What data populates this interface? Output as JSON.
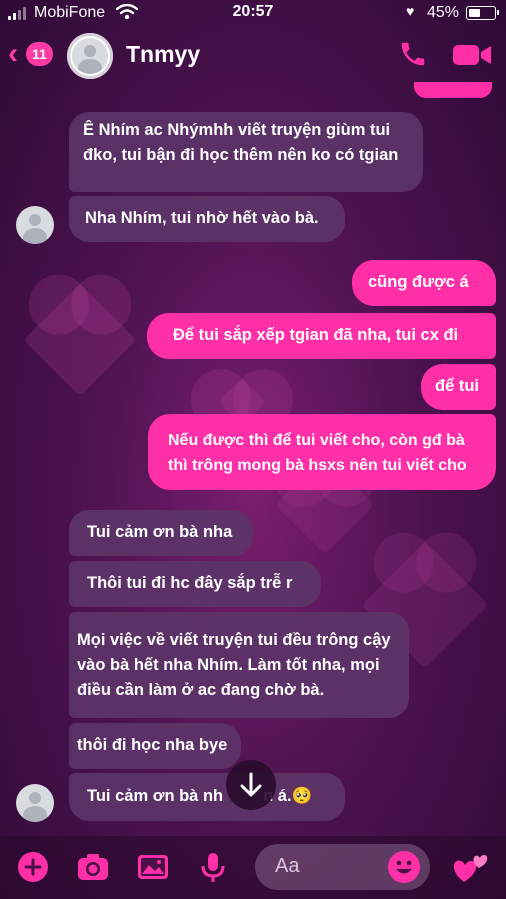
{
  "status_bar": {
    "carrier": "MobiFone",
    "time": "20:57",
    "battery_percent": "45%",
    "battery_level": 0.45
  },
  "header": {
    "back_badge": "11",
    "contact_name": "Tnmyy",
    "icons": [
      "back-chevron-icon",
      "avatar",
      "phone-icon",
      "video-icon"
    ]
  },
  "messages": [
    {
      "dir": "in",
      "text": "Ê Nhím ac Nhýmhh viết truyện giùm tui đko, tui bận đi học thêm nên ko có tgian"
    },
    {
      "dir": "in",
      "text": "Nha Nhím, tui nhờ hết vào bà."
    },
    {
      "dir": "out",
      "text": "cũng được á"
    },
    {
      "dir": "out",
      "text": "Để tui sắp xếp tgian đã nha, tui cx đi"
    },
    {
      "dir": "out",
      "text": "để tui"
    },
    {
      "dir": "out",
      "text": "Nếu được thì để tui viết cho, còn gđ bà thì trông mong bà hsxs nên tui viết cho"
    },
    {
      "dir": "in",
      "text": "Tui cảm ơn bà nha"
    },
    {
      "dir": "in",
      "text": "Thôi tui đi hc đây sắp trễ r"
    },
    {
      "dir": "in",
      "text": "Mọi việc về viết truyện tui đều trông cậy vào bà hết nha Nhím. Làm tốt nha, mọi điều cần làm ở ac đang chờ bà."
    },
    {
      "dir": "in",
      "text": "thôi đi học nha bye"
    },
    {
      "dir": "in",
      "text": "Tui cảm ơn bà nh",
      "text_tail": "n á.🥺"
    }
  ],
  "composer": {
    "placeholder": "Aa",
    "tool_icons": [
      "plus-icon",
      "camera-icon",
      "gallery-icon",
      "microphone-icon",
      "emoji-icon",
      "hearts-icon"
    ]
  },
  "colors": {
    "accent": "#ff2fa8",
    "incoming_bubble": "#5c3468",
    "background": "#4e1350"
  }
}
